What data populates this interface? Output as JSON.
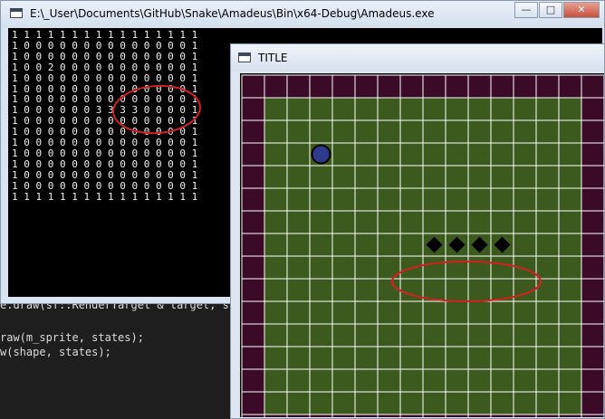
{
  "console_window": {
    "title": "E:\\_User\\Documents\\GitHub\\Snake\\Amadeus\\Bin\\x64-Debug\\Amadeus.exe",
    "buttons": {
      "minimize": "—",
      "maximize": "□",
      "close": "✕"
    },
    "matrix": [
      "1 1 1 1 1 1 1 1 1 1 1 1 1 1 1 1",
      "1 0 0 0 0 0 0 0 0 0 0 0 0 0 0 1",
      "1 0 0 0 0 0 0 0 0 0 0 0 0 0 0 1",
      "1 0 0 2 0 0 0 0 0 0 0 0 0 0 0 1",
      "1 0 0 0 0 0 0 0 0 0 0 0 0 0 0 1",
      "1 0 0 0 0 0 0 0 0 0 0 0 0 0 0 1",
      "1 0 0 0 0 0 0 0 0 0 0 0 0 0 0 1",
      "1 0 0 0 0 0 0 3 3 3 3 0 0 0 0 1",
      "1 0 0 0 0 0 0 0 0 0 0 0 0 0 0 1",
      "1 0 0 0 0 0 0 0 0 0 0 0 0 0 0 1",
      "1 0 0 0 0 0 0 0 0 0 0 0 0 0 0 1",
      "1 0 0 0 0 0 0 0 0 0 0 0 0 0 0 1",
      "1 0 0 0 0 0 0 0 0 0 0 0 0 0 0 1",
      "1 0 0 0 0 0 0 0 0 0 0 0 0 0 0 1",
      "1 0 0 0 0 0 0 0 0 0 0 0 0 0 0 1",
      "1 1 1 1 1 1 1 1 1 1 1 1 1 1 1 1"
    ]
  },
  "editor": {
    "lines": [
      "e.draw(sf::RenderTarget & target, s",
      "",
      "raw(m_sprite, states);",
      "w(shape, states);"
    ]
  },
  "game_window": {
    "title": "TITLE",
    "grid": {
      "size": 16,
      "wall_color": "#3a0a26",
      "floor_color": "#3c5a1e",
      "line_color": "#ffffff",
      "food": {
        "row": 3,
        "col": 3,
        "color": "#2e3a8c"
      },
      "snake": [
        {
          "row": 7,
          "col": 8
        },
        {
          "row": 7,
          "col": 9
        },
        {
          "row": 7,
          "col": 10
        },
        {
          "row": 7,
          "col": 11
        }
      ],
      "snake_color": "#000000"
    },
    "annotation_color": "#d42020"
  }
}
